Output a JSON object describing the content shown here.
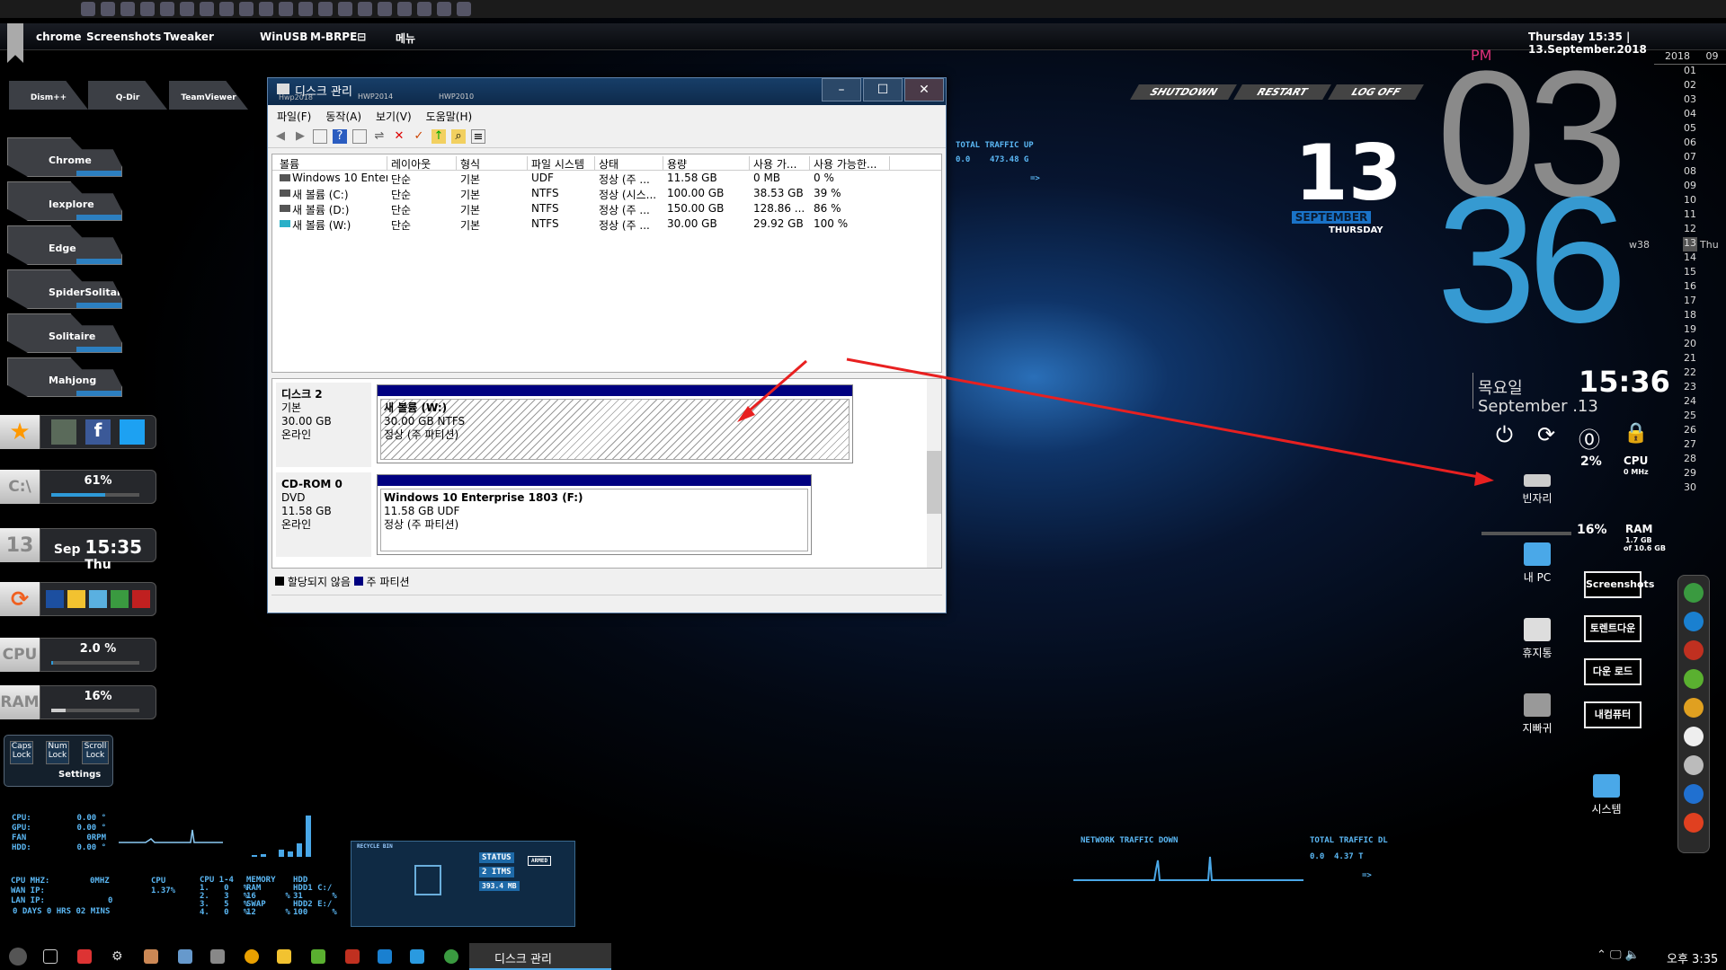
{
  "top_menu": {
    "items": [
      "chrome",
      "Screenshots",
      "Tweaker",
      "WinUSB",
      "M-BRPE⊟",
      "메뉴"
    ],
    "datetime": "Thursday 15:35 | 13.September.2018"
  },
  "app_tabs": [
    "Dism++",
    "Q-Dir",
    "TeamViewer",
    "Hwp2018",
    "HWP2014",
    "HWP2010"
  ],
  "launchers": [
    "Chrome",
    "Iexplore",
    "Edge",
    "SpiderSolitaire",
    "Solitaire",
    "Mahjong"
  ],
  "widgets": {
    "c_drive": {
      "label": "C:\\",
      "value": "61%",
      "fill": 61
    },
    "date": {
      "day": "13",
      "month": "Sep",
      "time": "15:35",
      "weekday": "Thu"
    },
    "cpu": {
      "label": "CPU",
      "value": "2.0 %",
      "fill": 2
    },
    "ram": {
      "label": "RAM",
      "value": "16%",
      "fill": 16
    },
    "locks": [
      "Caps Lock",
      "Num Lock",
      "Scroll Lock"
    ],
    "settings": "Settings"
  },
  "power_buttons": [
    "SHUTDOWN",
    "RESTART",
    "LOG OFF"
  ],
  "traffic_up": {
    "title": "TOTAL TRAFFIC UP",
    "current": "0.0",
    "total": "473.48 G",
    "arrow": "=>"
  },
  "traffic_down": {
    "title": "NETWORK TRAFFIC DOWN",
    "total_title": "TOTAL TRAFFIC DL",
    "current": "0.0",
    "total": "4.37 T",
    "arrow": "=>"
  },
  "big_date": {
    "day": "13",
    "month": "SEPTEMBER",
    "weekday": "THURSDAY"
  },
  "clock": {
    "ampm": "PM",
    "hour": "03",
    "minute": "36",
    "weekday_kr": "목요일",
    "date": "September .13",
    "time24": "15:36"
  },
  "calendar": {
    "year": "2018",
    "month": "09",
    "week": "w38",
    "today": "13",
    "today_name": "Thu",
    "days": [
      "01",
      "02",
      "03",
      "04",
      "05",
      "06",
      "07",
      "08",
      "09",
      "10",
      "11",
      "12",
      "13",
      "14",
      "15",
      "16",
      "17",
      "18",
      "19",
      "20",
      "21",
      "22",
      "23",
      "24",
      "25",
      "26",
      "27",
      "28",
      "29",
      "30"
    ]
  },
  "sysmon": {
    "cpu": "2%",
    "cpu_label": "CPU",
    "cpu_mhz": "0 MHz",
    "ram": "16%",
    "ram_label": "RAM",
    "ram_used": "1.7 GB",
    "ram_total": "of 10.6 GB"
  },
  "desktop_icons": [
    "빈자리",
    "내 PC",
    "휴지통",
    "지빠귀",
    "시스템"
  ],
  "folders": [
    "Screenshots",
    "토렌트다운",
    "다운 로드",
    "내컴퓨터"
  ],
  "hw": {
    "labels": [
      "CPU:",
      "GPU:",
      "FAN",
      "HDD:"
    ],
    "values": [
      "0.00 °",
      "0.00 °",
      "0RPM",
      "0.00 °"
    ],
    "cpu_mhz_label": "CPU MHZ:",
    "cpu_mhz": "0MHZ",
    "wan": "WAN IP:",
    "lan": "LAN IP:",
    "lan_val": "0",
    "uptime": "0 DAYS  0 HRS 02 MINS",
    "cpu_col": "CPU",
    "cpu_val": "1.37%",
    "cores_title": "CPU 1-4",
    "cores": [
      "1.   0   %",
      "2.   3   %",
      "3.   5   %",
      "4.   0   %"
    ],
    "mem_title": "MEMORY",
    "mem": [
      "RAM",
      "16      %",
      "SWAP",
      "12      %"
    ],
    "hdd_title": "HDD",
    "hdd": [
      "HDD1 C:/",
      "31      %",
      "HDD2 E:/",
      "100     %"
    ]
  },
  "recycle": {
    "title": "RECYCLE BIN",
    "status": "STATUS",
    "items": "2 ITMS",
    "size": "393.4 MB",
    "armed": "ARMED"
  },
  "window": {
    "title": "디스크 관리",
    "menu": [
      "파일(F)",
      "동작(A)",
      "보기(V)",
      "도움말(H)"
    ],
    "columns": [
      "볼륨",
      "레이아웃",
      "형식",
      "파일 시스템",
      "상태",
      "용량",
      "사용 가...",
      "사용 가능한..."
    ],
    "rows": [
      [
        "Windows 10 Enter...",
        "단순",
        "기본",
        "UDF",
        "정상 (주 ...",
        "11.58 GB",
        "0 MB",
        "0 %"
      ],
      [
        "새 볼륨 (C:)",
        "단순",
        "기본",
        "NTFS",
        "정상 (시스...",
        "100.00 GB",
        "38.53 GB",
        "39 %"
      ],
      [
        "새 볼륨 (D:)",
        "단순",
        "기본",
        "NTFS",
        "정상 (주 ...",
        "150.00 GB",
        "128.86 ...",
        "86 %"
      ],
      [
        "새 볼륨 (W:)",
        "단순",
        "기본",
        "NTFS",
        "정상 (주 ...",
        "30.00 GB",
        "29.92 GB",
        "100 %"
      ]
    ],
    "disks": [
      {
        "name": "디스크 2",
        "type": "기본",
        "size": "30.00 GB",
        "state": "온라인",
        "part_name": "새 볼륨  (W:)",
        "part_size": "30.00 GB NTFS",
        "part_state": "정상 (주 파티션)"
      },
      {
        "name": "CD-ROM 0",
        "type": "DVD",
        "size": "11.58 GB",
        "state": "온라인",
        "part_name": "Windows 10 Enterprise 1803  (F:)",
        "part_size": "11.58 GB UDF",
        "part_state": "정상 (주 파티션)"
      }
    ],
    "legend": [
      "할당되지 않음",
      "주 파티션"
    ]
  },
  "taskbar": {
    "active": "디스크 관리",
    "time": "오후 3:35"
  },
  "colors": {
    "accent": "#2e9ad8",
    "partition": "#000080",
    "arrow": "#e82020",
    "pm": "#e0307a"
  }
}
